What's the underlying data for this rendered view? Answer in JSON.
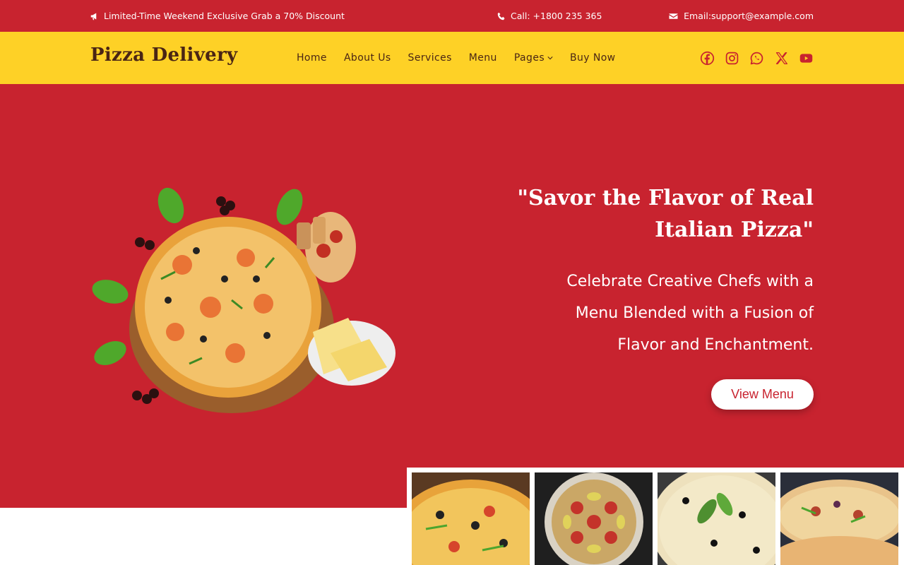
{
  "topbar": {
    "promo": "Limited-Time Weekend Exclusive Grab a 70% Discount",
    "call": "Call: +1800 235 365",
    "email": "Email:support@example.com"
  },
  "nav": {
    "logo": "Pizza Delivery",
    "items": [
      "Home",
      "About Us",
      "Services",
      "Menu",
      "Pages",
      "Buy Now"
    ],
    "social_icons": [
      "facebook-icon",
      "instagram-icon",
      "whatsapp-icon",
      "x-icon",
      "youtube-icon"
    ]
  },
  "hero": {
    "title": "\"Savor the Flavor of Real Italian Pizza\"",
    "subtitle": "Celebrate Creative Chefs with a Menu Blended with a Fusion of Flavor and Enchantment.",
    "button": "View Menu"
  },
  "colors": {
    "primary_red": "#c8232f",
    "accent_yellow": "#fed126",
    "brand_brown": "#4a2514"
  }
}
